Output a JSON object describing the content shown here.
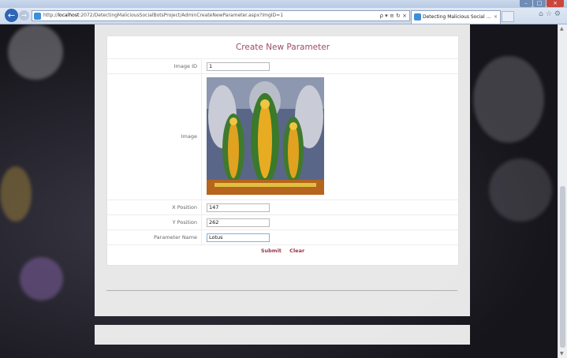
{
  "browser": {
    "url_prefix": "http://",
    "url_host": "localhost",
    "url_rest": ":2072/DetectingMaliciousSocialBotsProject/AdminCreateNewParameter.aspx?ImgID=1",
    "address_controls": "ρ ▾ ≡ ↻ ×",
    "tab_title": "Detecting Malicious Social ...",
    "tab_close": "×",
    "back_glyph": "←",
    "forward_glyph": "→",
    "tools_glyphs": "⌂☆⚙",
    "window_buttons": [
      "–",
      "□",
      "×"
    ]
  },
  "form": {
    "title": "Create New Parameter",
    "image_id_label": "Image ID",
    "image_id_value": "1",
    "image_label": "Image",
    "x_label": "X Position",
    "x_value": "147",
    "y_label": "Y Position",
    "y_value": "262",
    "param_label": "Parameter Name",
    "param_value": "Lotus",
    "submit_label": "Submit",
    "clear_label": "Clear"
  },
  "colors": {
    "title": "#9b4d60",
    "action_links": "#9b3348",
    "browser_accent": "#2e66b5"
  },
  "icons": {
    "back": "back-arrow-icon",
    "forward": "forward-arrow-icon",
    "page": "ie-page-icon"
  }
}
